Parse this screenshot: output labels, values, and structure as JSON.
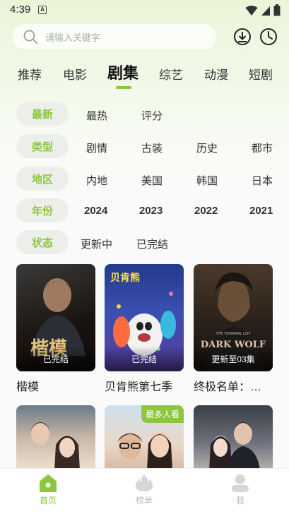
{
  "status_bar": {
    "time": "4:39",
    "notif_letter": "A"
  },
  "search": {
    "placeholder": "请输入关键字"
  },
  "header_icons": [
    "download-icon",
    "history-icon"
  ],
  "tabs": [
    {
      "label": "推荐"
    },
    {
      "label": "电影"
    },
    {
      "label": "剧集"
    },
    {
      "label": "综艺"
    },
    {
      "label": "动漫"
    },
    {
      "label": "短剧"
    }
  ],
  "active_tab": "剧集",
  "filters": {
    "sort": {
      "label": "最新",
      "options": [
        "最热",
        "评分"
      ]
    },
    "type": {
      "label": "类型",
      "options": [
        "剧情",
        "古装",
        "历史",
        "都市"
      ]
    },
    "region": {
      "label": "地区",
      "options": [
        "内地",
        "美国",
        "韩国",
        "日本"
      ]
    },
    "year": {
      "label": "年份",
      "options": [
        "2024",
        "2023",
        "2022",
        "2021"
      ]
    },
    "state": {
      "label": "状态",
      "options": [
        "更新中",
        "已完结"
      ]
    }
  },
  "cards": [
    {
      "title": "楷模",
      "status": "已完结",
      "poster_text": "楷模"
    },
    {
      "title": "贝肯熊第七季",
      "status": "已完结",
      "poster_text": "贝肯熊"
    },
    {
      "title": "终极名单：…",
      "status": "更新至03集",
      "poster_text": "DARK WOLF",
      "poster_sub": "THE TERMINAL LIST"
    }
  ],
  "cards_row2": [
    {
      "badge": ""
    },
    {
      "badge": "最多人看"
    },
    {
      "badge": ""
    }
  ],
  "bottom_nav": [
    {
      "label": "首页",
      "icon": "home-icon",
      "active": true
    },
    {
      "label": "榜单",
      "icon": "flame-icon",
      "active": false
    },
    {
      "label": "我",
      "icon": "user-icon",
      "active": false
    }
  ],
  "colors": {
    "accent": "#8dc63f",
    "pill_bg": "#eceeea"
  }
}
